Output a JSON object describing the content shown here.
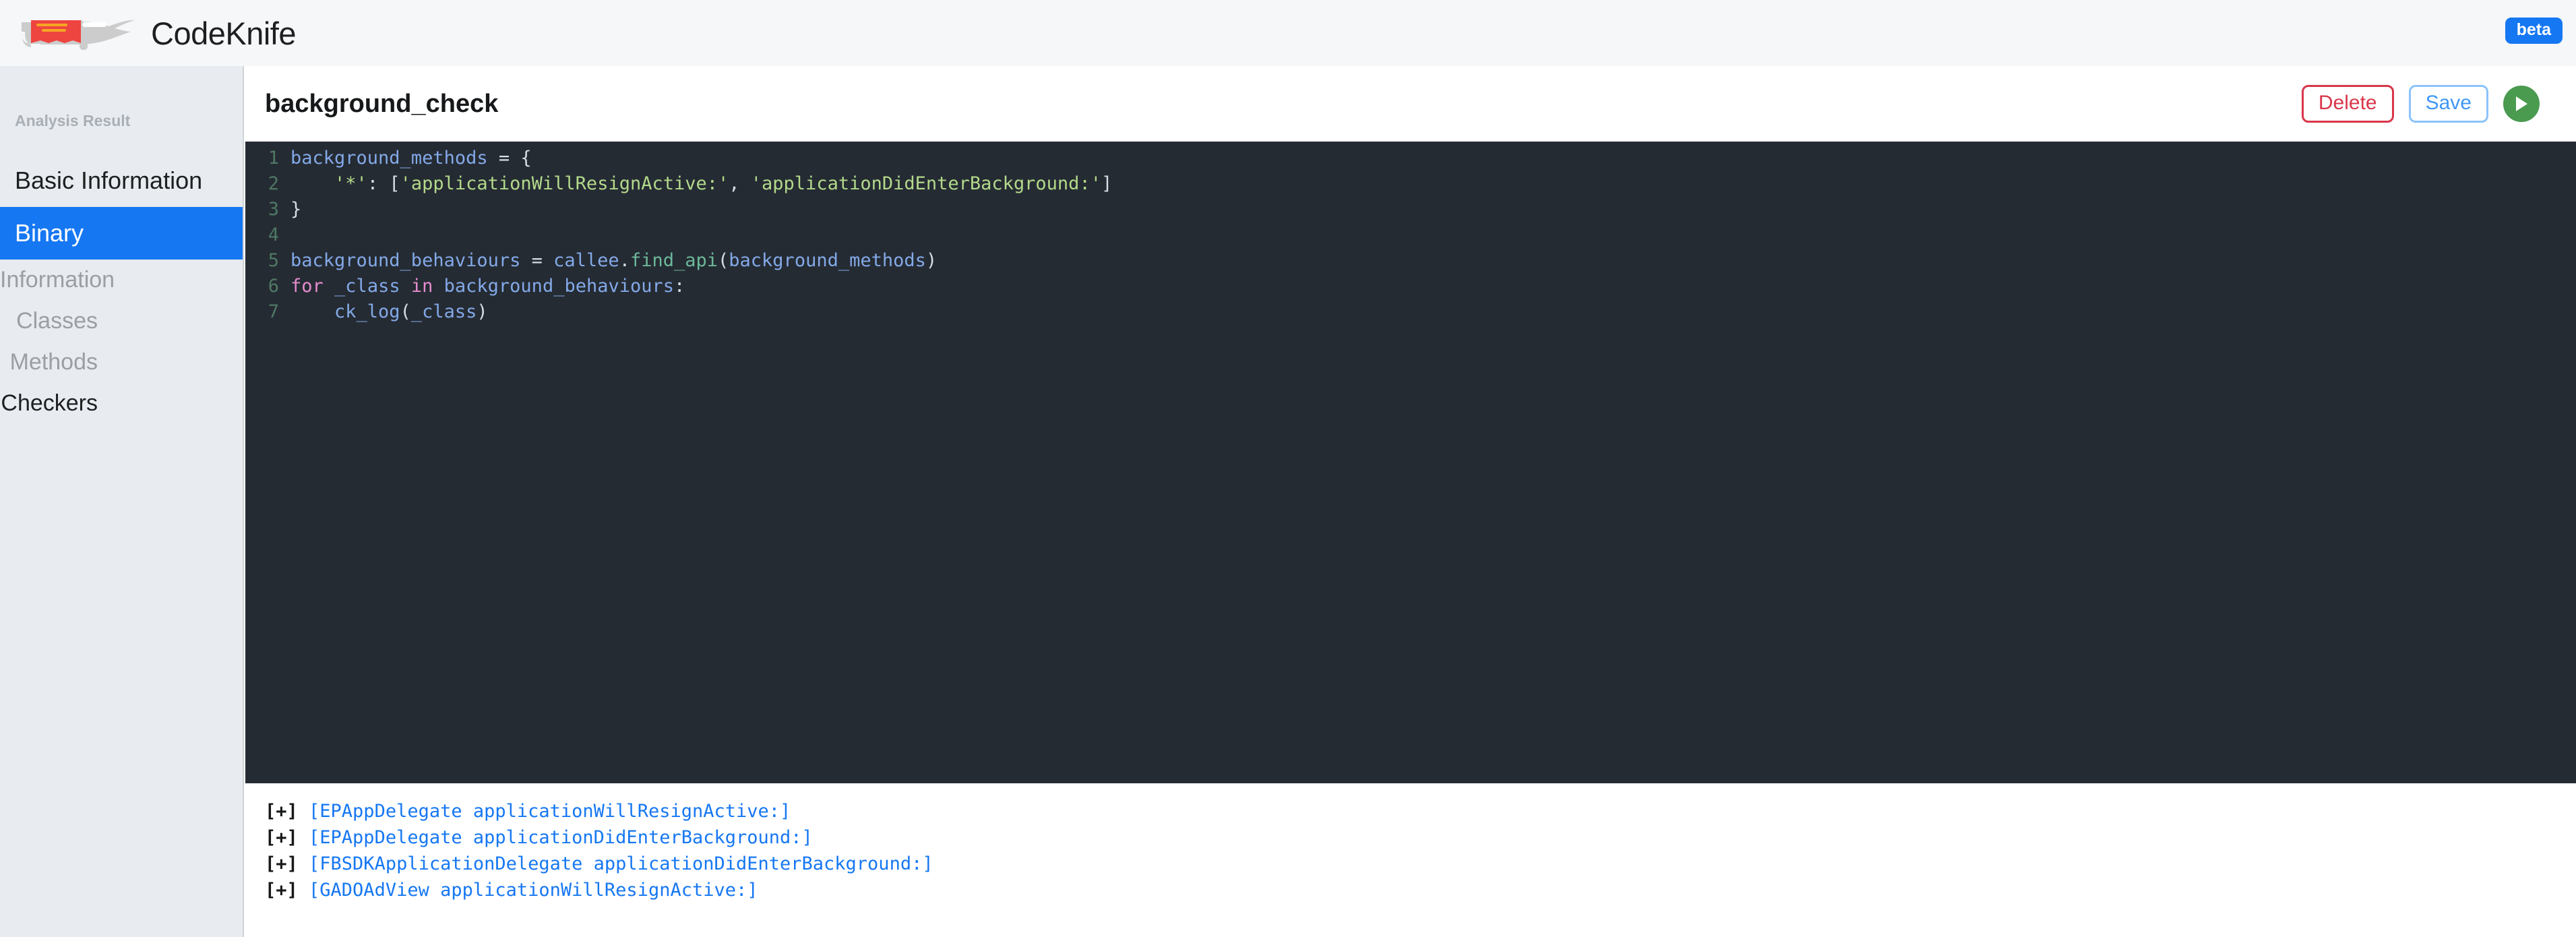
{
  "app": {
    "brand_name": "CodeKnife",
    "logo_icon": "swiss-army-knife-icon",
    "beta_label": "beta"
  },
  "sidebar": {
    "caption": "Analysis Result",
    "top_items": [
      {
        "label": "Basic Information",
        "active": false
      },
      {
        "label": "Binary",
        "active": true
      }
    ],
    "sub_items": [
      {
        "label": "Information",
        "current": false
      },
      {
        "label": "Classes",
        "current": false
      },
      {
        "label": "Methods",
        "current": false
      },
      {
        "label": "Checkers",
        "current": true
      }
    ]
  },
  "content": {
    "title": "background_check",
    "actions": {
      "delete_label": "Delete",
      "save_label": "Save",
      "run_icon": "play-icon"
    }
  },
  "editor": {
    "language": "python",
    "lines": [
      {
        "no": "1",
        "tokens": [
          {
            "t": "background_methods",
            "c": "tok-var"
          },
          {
            "t": " = {",
            "c": "tok-pun"
          }
        ]
      },
      {
        "no": "2",
        "tokens": [
          {
            "t": "    ",
            "c": "tok-pun"
          },
          {
            "t": "'*'",
            "c": "tok-str"
          },
          {
            "t": ": [",
            "c": "tok-pun"
          },
          {
            "t": "'applicationWillResignActive:'",
            "c": "tok-str"
          },
          {
            "t": ", ",
            "c": "tok-pun"
          },
          {
            "t": "'applicationDidEnterBackground:'",
            "c": "tok-str"
          },
          {
            "t": "]",
            "c": "tok-pun"
          }
        ]
      },
      {
        "no": "3",
        "tokens": [
          {
            "t": "}",
            "c": "tok-pun"
          }
        ]
      },
      {
        "no": "4",
        "tokens": []
      },
      {
        "no": "5",
        "tokens": [
          {
            "t": "background_behaviours",
            "c": "tok-var"
          },
          {
            "t": " = ",
            "c": "tok-pun"
          },
          {
            "t": "callee",
            "c": "tok-var"
          },
          {
            "t": ".",
            "c": "tok-pun"
          },
          {
            "t": "find_api",
            "c": "tok-fn"
          },
          {
            "t": "(",
            "c": "tok-pun"
          },
          {
            "t": "background_methods",
            "c": "tok-var"
          },
          {
            "t": ")",
            "c": "tok-pun"
          }
        ]
      },
      {
        "no": "6",
        "tokens": [
          {
            "t": "for",
            "c": "tok-kw"
          },
          {
            "t": " ",
            "c": "tok-pun"
          },
          {
            "t": "_class",
            "c": "tok-var"
          },
          {
            "t": " ",
            "c": "tok-pun"
          },
          {
            "t": "in",
            "c": "tok-kw"
          },
          {
            "t": " ",
            "c": "tok-pun"
          },
          {
            "t": "background_behaviours",
            "c": "tok-var"
          },
          {
            "t": ":",
            "c": "tok-pun"
          }
        ]
      },
      {
        "no": "7",
        "tokens": [
          {
            "t": "    ",
            "c": "tok-pun"
          },
          {
            "t": "ck_log",
            "c": "tok-var"
          },
          {
            "t": "(",
            "c": "tok-pun"
          },
          {
            "t": "_class",
            "c": "tok-var"
          },
          {
            "t": ")",
            "c": "tok-pun"
          }
        ]
      }
    ]
  },
  "console": {
    "lines": [
      {
        "prefix": "[+] ",
        "text": "[EPAppDelegate applicationWillResignActive:]"
      },
      {
        "prefix": "[+] ",
        "text": "[EPAppDelegate applicationDidEnterBackground:]"
      },
      {
        "prefix": "[+] ",
        "text": "[FBSDKApplicationDelegate applicationDidEnterBackground:]"
      },
      {
        "prefix": "[+] ",
        "text": "[GADOAdView applicationWillResignActive:]"
      }
    ]
  },
  "colors": {
    "accent_blue": "#1677f2",
    "danger_red": "#d9364a",
    "run_green": "#4a9a50",
    "editor_bg": "#252b33",
    "sidebar_bg": "#e8ebef",
    "logo_red": "#ee4540",
    "logo_gray": "#cccccc",
    "logo_stripe": "#f5a623"
  }
}
